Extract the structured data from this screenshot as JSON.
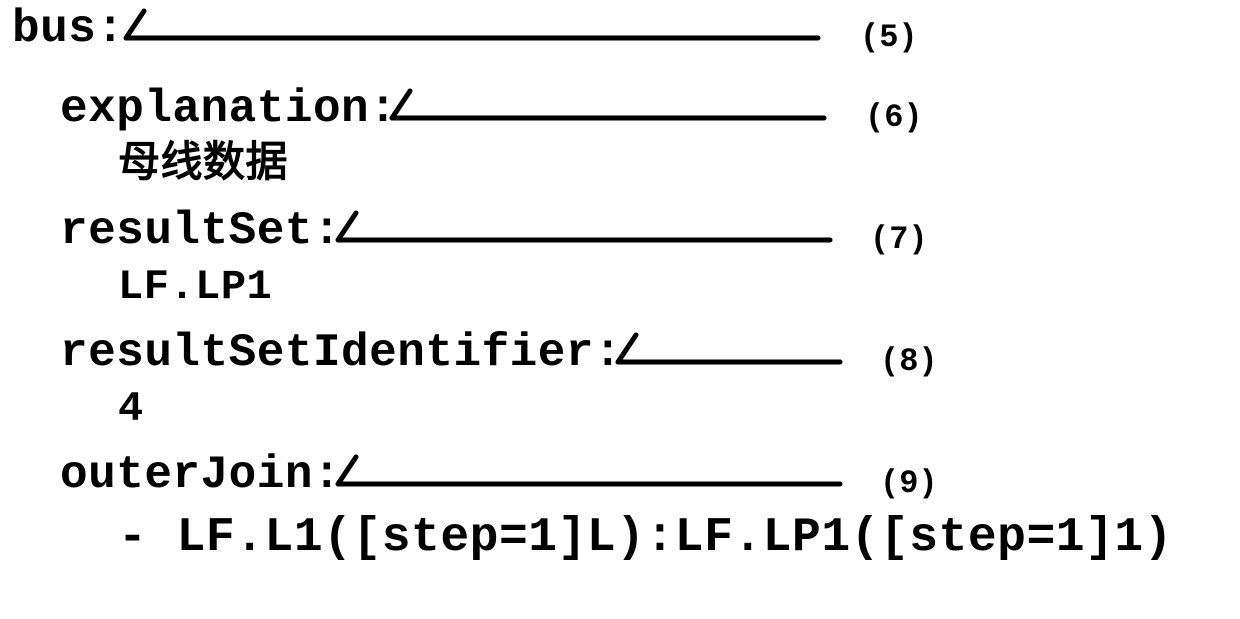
{
  "lines": {
    "l1": {
      "key": "bus:",
      "num": "(5)"
    },
    "l2": {
      "key": "explanation:",
      "num": "(6)"
    },
    "l3": {
      "val": "母线数据"
    },
    "l4": {
      "key": "resultSet:",
      "num": "(7)"
    },
    "l5": {
      "val": "LF.LP1"
    },
    "l6": {
      "key": "resultSetIdentifier:",
      "num": "(8)"
    },
    "l7": {
      "val": "4"
    },
    "l8": {
      "key": "outerJoin:",
      "num": "(9)"
    },
    "l9": {
      "val": "- LF.L1([step=1]L):LF.LP1([step=1]1)"
    }
  }
}
